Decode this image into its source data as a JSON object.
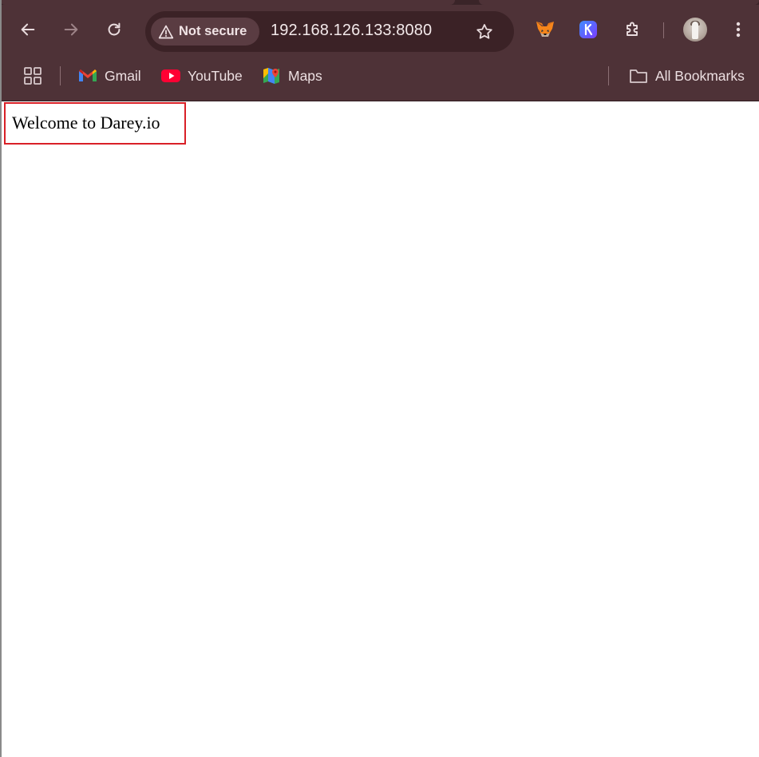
{
  "browser": {
    "security_chip": {
      "label": "Not secure",
      "icon": "warning-triangle-icon"
    },
    "url": "192.168.126.133:8080",
    "nav_icons": [
      "back-arrow-icon",
      "forward-arrow-icon",
      "reload-icon"
    ],
    "extensions": [
      "metamask-fox-icon",
      "k-extension-icon",
      "puzzle-icon"
    ],
    "menu_icon": "more-vert-icon"
  },
  "bookmarks": {
    "apps_icon": "apps-grid-icon",
    "items": [
      {
        "label": "Gmail",
        "icon": "gmail-icon"
      },
      {
        "label": "YouTube",
        "icon": "youtube-icon"
      },
      {
        "label": "Maps",
        "icon": "maps-icon"
      }
    ],
    "all_bookmarks": {
      "label": "All Bookmarks",
      "icon": "folder-icon"
    }
  },
  "page": {
    "welcome_text": "Welcome to Darey.io"
  },
  "colors": {
    "chrome_frame": "#4e3237",
    "omnibox": "#3b2226",
    "highlight_border": "#d92027"
  }
}
